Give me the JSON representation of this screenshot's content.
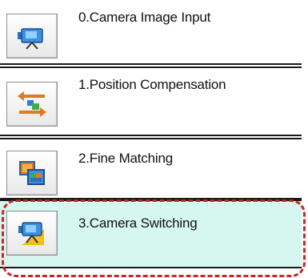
{
  "flow": {
    "items": [
      {
        "label": "0.Camera Image Input",
        "icon": "camera-icon",
        "selected": false
      },
      {
        "label": "1.Position Compensation",
        "icon": "position-compensation-icon",
        "selected": false
      },
      {
        "label": "2.Fine Matching",
        "icon": "fine-matching-icon",
        "selected": false
      },
      {
        "label": "3.Camera Switching",
        "icon": "camera-switching-icon",
        "selected": true
      }
    ]
  },
  "colors": {
    "selected_background": "#d6f7ef",
    "highlight_dash": "#c62828"
  }
}
